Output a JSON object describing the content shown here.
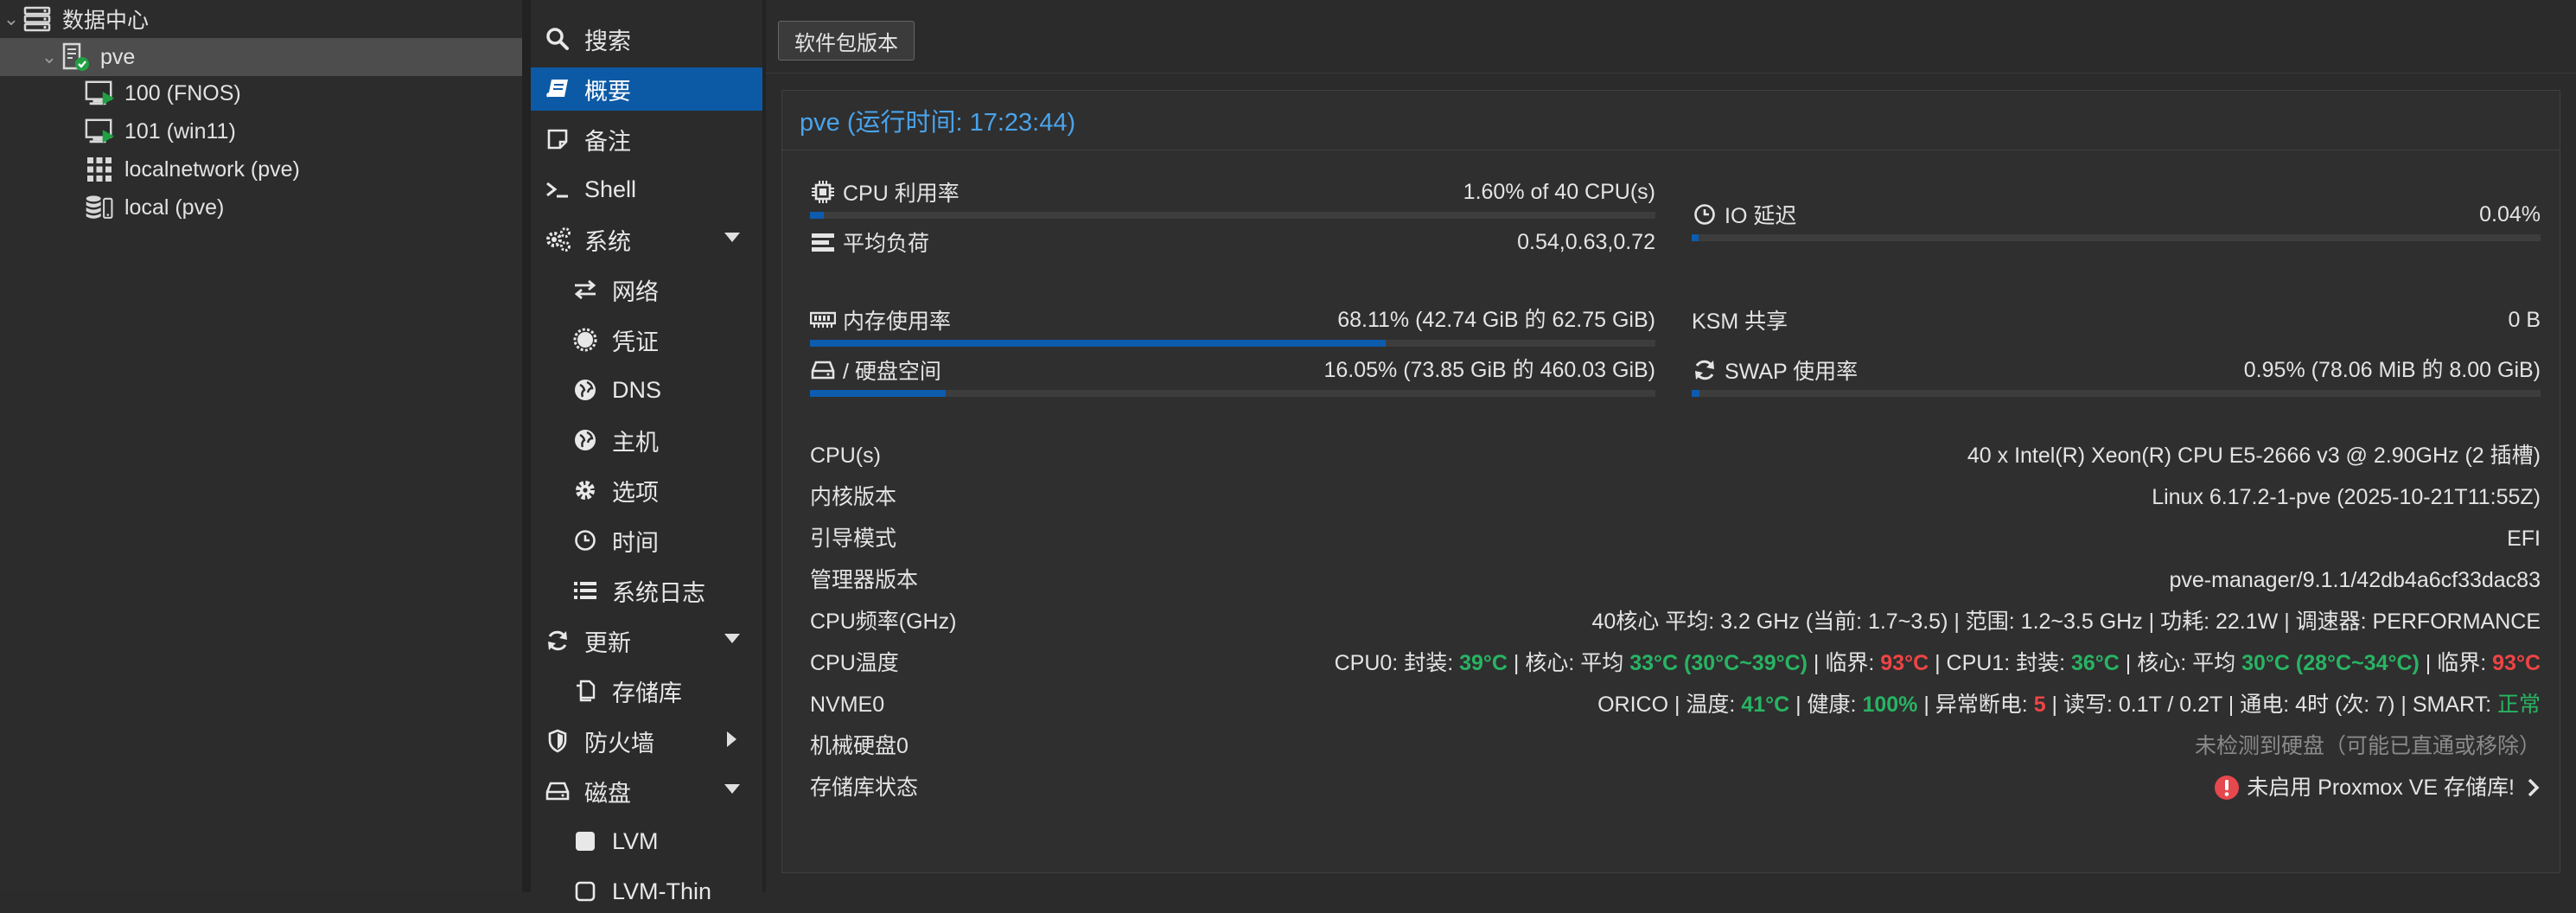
{
  "tree": {
    "datacenter": "数据中心",
    "node": "pve",
    "items": [
      {
        "label": "100 (FNOS)"
      },
      {
        "label": "101 (win11)"
      },
      {
        "label": "localnetwork (pve)"
      },
      {
        "label": "local (pve)"
      }
    ]
  },
  "nav": {
    "search": "搜索",
    "summary": "概要",
    "notes": "备注",
    "shell": "Shell",
    "system": "系统",
    "network": "网络",
    "certificates": "凭证",
    "dns": "DNS",
    "hosts": "主机",
    "options": "选项",
    "time": "时间",
    "syslog": "系统日志",
    "updates": "更新",
    "repositories": "存储库",
    "firewall": "防火墙",
    "disks": "磁盘",
    "lvm": "LVM",
    "lvm_thin": "LVM-Thin"
  },
  "toolbar": {
    "packages_button": "软件包版本"
  },
  "panel": {
    "title": "pve (运行时间: 17:23:44)"
  },
  "stats": {
    "cpu": {
      "label": "CPU 利用率",
      "value": "1.60% of 40 CPU(s)",
      "fraction": 0.016
    },
    "load": {
      "label": "平均负荷",
      "value": "0.54,0.63,0.72"
    },
    "io": {
      "label": "IO 延迟",
      "value": "0.04%",
      "fraction": 0.0004
    },
    "memory": {
      "label": "内存使用率",
      "value": "68.11% (42.74 GiB 的 62.75 GiB)",
      "fraction": 0.6811
    },
    "ksm": {
      "label": "KSM 共享",
      "value": "0 B"
    },
    "rootfs": {
      "label": "/ 硬盘空间",
      "value": "16.05% (73.85 GiB 的 460.03 GiB)",
      "fraction": 0.1605
    },
    "swap": {
      "label": "SWAP 使用率",
      "value": "0.95% (78.06 MiB 的 8.00 GiB)",
      "fraction": 0.0095
    }
  },
  "info": {
    "cpus": {
      "label": "CPU(s)",
      "value": "40 x Intel(R) Xeon(R) CPU E5-2666 v3 @ 2.90GHz (2 插槽)"
    },
    "kernel": {
      "label": "内核版本",
      "value": "Linux 6.17.2-1-pve (2025-10-21T11:55Z)"
    },
    "boot": {
      "label": "引导模式",
      "value": "EFI"
    },
    "manager": {
      "label": "管理器版本",
      "value": "pve-manager/9.1.1/42db4a6cf33dac83"
    },
    "cpufreq": {
      "label": "CPU频率(GHz)",
      "value": "40核心 平均: 3.2 GHz (当前: 1.7~3.5) | 范围: 1.2~3.5 GHz | 功耗: 22.1W | 调速器: PERFORMANCE"
    },
    "cputemp": {
      "label": "CPU温度",
      "cpu0_prefix": "CPU0: 封装: ",
      "cpu0_pkg": "39°C",
      "cpu0_core_text": " | 核心: 平均 ",
      "cpu0_core_avg": "33°C",
      "cpu0_range": "(30°C~39°C)",
      "crit_text": " | 临界: ",
      "cpu0_crit": "93°C",
      "cpu1_prefix": " | CPU1: 封装: ",
      "cpu1_pkg": "36°C",
      "cpu1_core_text": " | 核心: 平均 ",
      "cpu1_core_avg": "30°C",
      "cpu1_range": "(28°C~34°C)",
      "cpu1_crit": "93°C"
    },
    "nvme": {
      "label": "NVME0",
      "prefix": "ORICO | 温度: ",
      "temp": "41°C",
      "health_text": " | 健康: ",
      "health": "100%",
      "unsafe_text": " | 异常断电: ",
      "unsafe": "5",
      "rest_text": " | 读写: 0.1T / 0.2T | 通电: 4时 (次: 7) | SMART: ",
      "smart": "正常"
    },
    "hdd": {
      "label": "机械硬盘0",
      "value": "未检测到硬盘（可能已直通或移除）"
    },
    "repo": {
      "label": "存储库状态",
      "value": "未启用 Proxmox VE 存储库!"
    }
  },
  "colors": {
    "accent": "#0c5aa6",
    "title": "#4aa3ea",
    "ok": "#28b463",
    "danger": "#ef4444"
  }
}
